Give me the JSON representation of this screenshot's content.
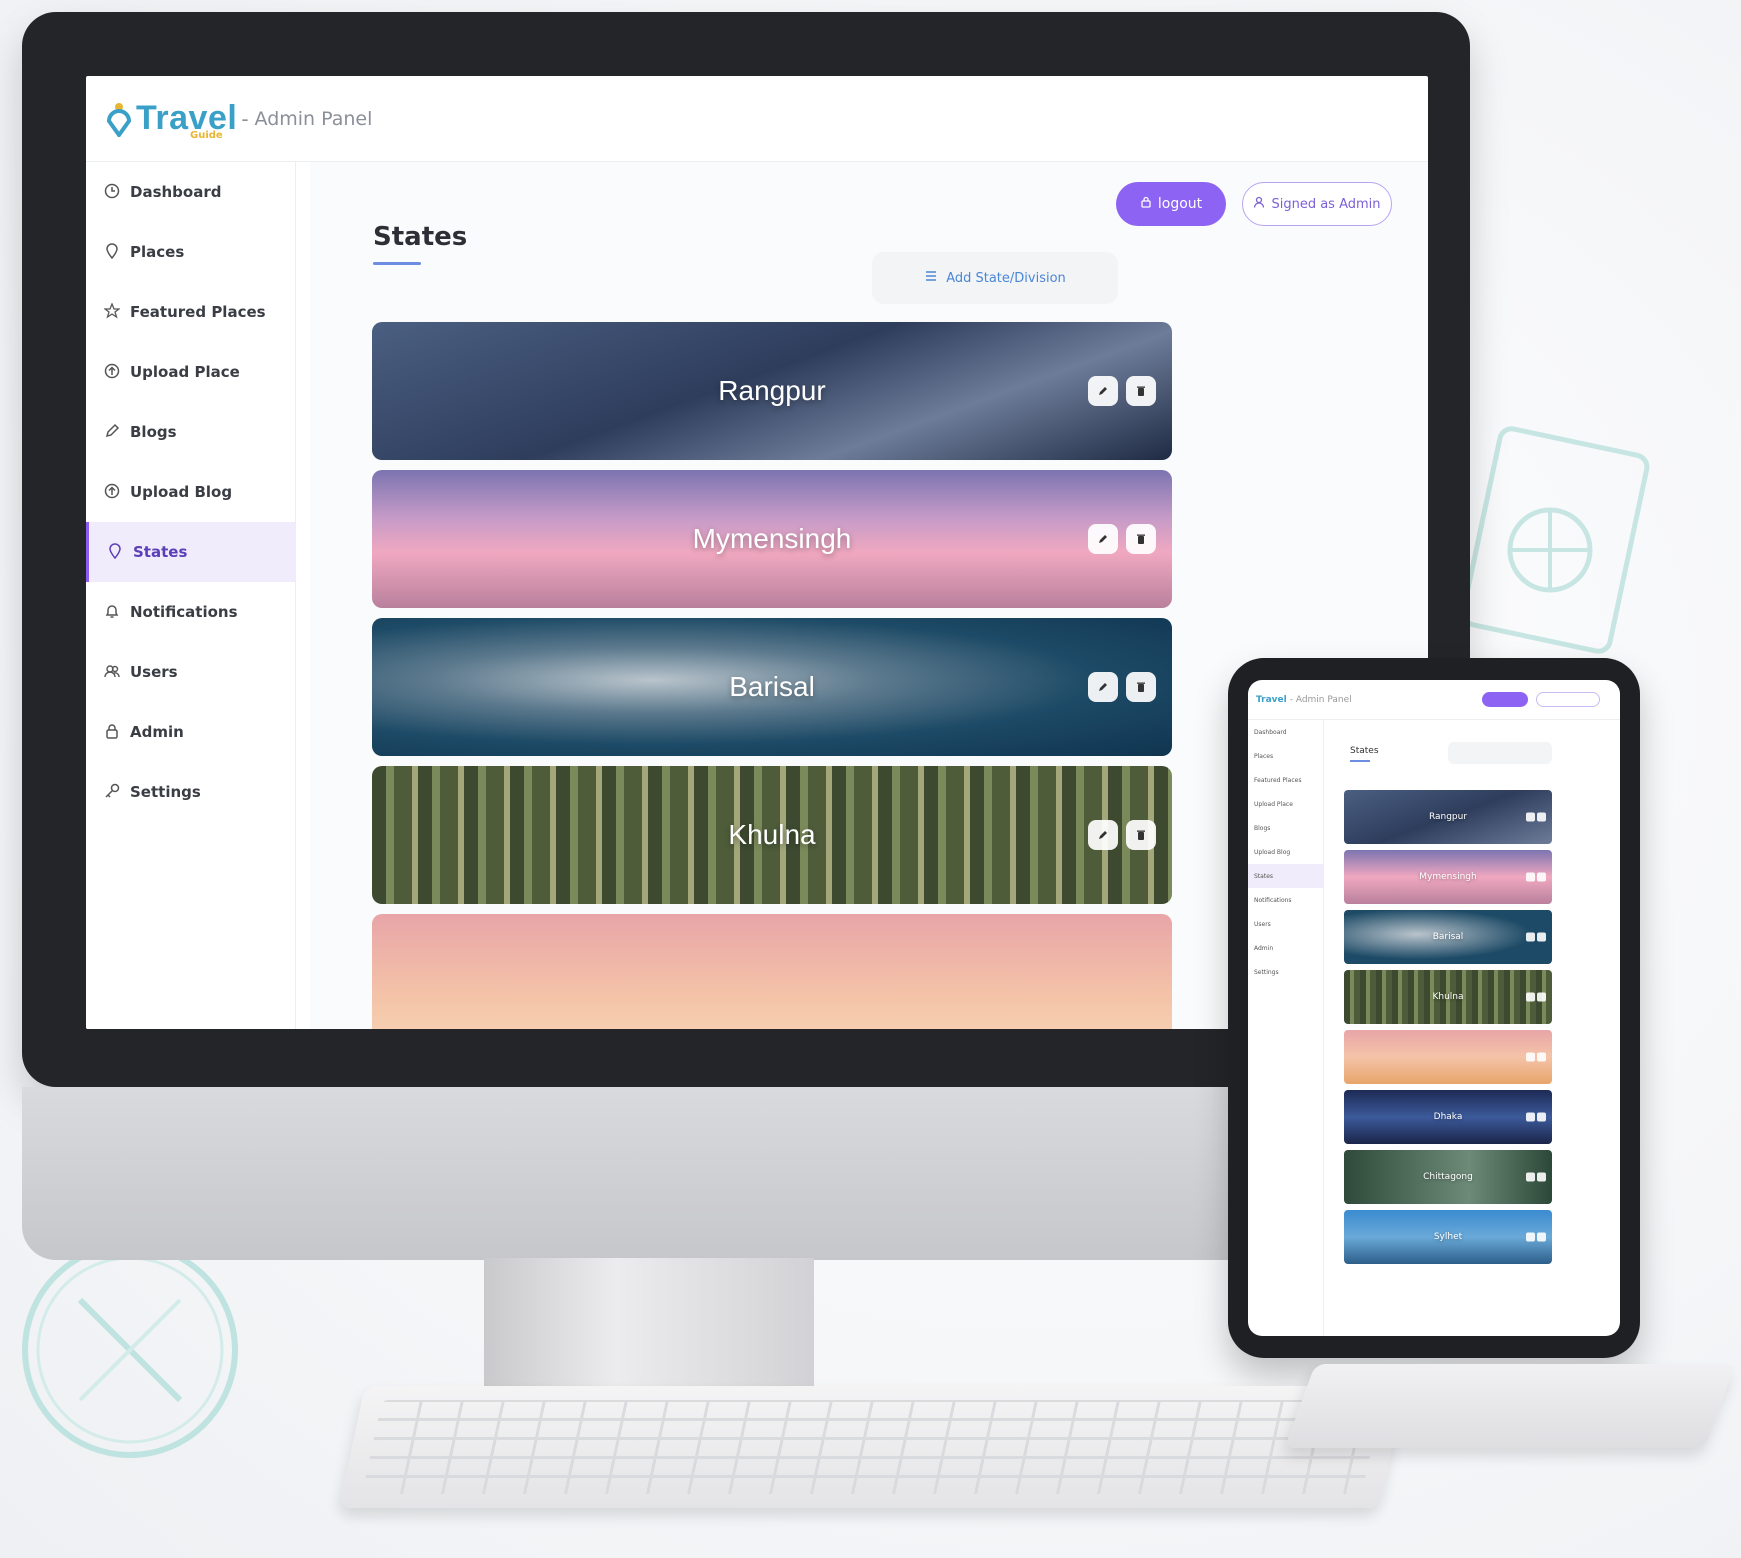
{
  "app": {
    "logo_text": "Travel",
    "logo_sub": "Guide",
    "separator": "-",
    "panel_title": "Admin Panel"
  },
  "sidebar": {
    "items": [
      {
        "label": "Dashboard",
        "icon": "clock-icon"
      },
      {
        "label": "Places",
        "icon": "pin-icon"
      },
      {
        "label": "Featured Places",
        "icon": "star-icon"
      },
      {
        "label": "Upload Place",
        "icon": "upload-icon"
      },
      {
        "label": "Blogs",
        "icon": "pencil-icon"
      },
      {
        "label": "Upload Blog",
        "icon": "upload-icon"
      },
      {
        "label": "States",
        "icon": "pin-icon",
        "active": true
      },
      {
        "label": "Notifications",
        "icon": "bell-icon"
      },
      {
        "label": "Users",
        "icon": "users-icon"
      },
      {
        "label": "Admin",
        "icon": "lock-icon"
      },
      {
        "label": "Settings",
        "icon": "key-icon"
      }
    ]
  },
  "header": {
    "logout_label": "logout",
    "signed_label": "Signed as Admin"
  },
  "main": {
    "title": "States",
    "add_button_label": "Add State/Division"
  },
  "states": [
    {
      "name": "Rangpur"
    },
    {
      "name": "Mymensingh"
    },
    {
      "name": "Barisal"
    },
    {
      "name": "Khulna"
    },
    {
      "name": ""
    }
  ],
  "tablet": {
    "logo_text": "Travel",
    "panel_title": "- Admin Panel",
    "title": "States",
    "states": [
      "Rangpur",
      "Mymensingh",
      "Barisal",
      "Khulna",
      "",
      "Dhaka",
      "Chittagong",
      "Sylhet"
    ]
  },
  "colors": {
    "accent": "#8c63f2",
    "brand": "#3aa0c8",
    "active_bg": "#f1ecfb"
  }
}
